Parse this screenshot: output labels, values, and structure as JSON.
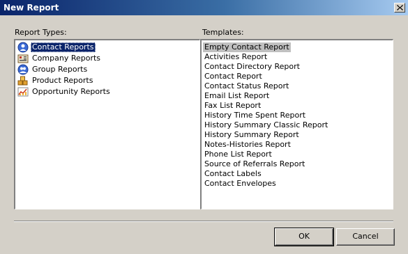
{
  "window": {
    "title": "New Report",
    "close_icon": "close-icon"
  },
  "report_types": {
    "label": "Report Types:",
    "items": [
      {
        "label": "Contact Reports",
        "icon": "contact-icon",
        "selected": true
      },
      {
        "label": "Company Reports",
        "icon": "company-icon",
        "selected": false
      },
      {
        "label": "Group Reports",
        "icon": "group-icon",
        "selected": false
      },
      {
        "label": "Product Reports",
        "icon": "product-icon",
        "selected": false
      },
      {
        "label": "Opportunity Reports",
        "icon": "opportunity-icon",
        "selected": false
      }
    ]
  },
  "templates": {
    "label": "Templates:",
    "items": [
      "Empty Contact Report",
      "Activities Report",
      "Contact Directory Report",
      "Contact Report",
      "Contact Status Report",
      "Email List Report",
      "Fax List Report",
      "History Time Spent Report",
      "History Summary Classic Report",
      "History Summary Report",
      "Notes-Histories Report",
      "Phone List Report",
      "Source of Referrals Report",
      "Contact Labels",
      "Contact Envelopes"
    ],
    "selected_index": 0
  },
  "buttons": {
    "ok": "OK",
    "cancel": "Cancel"
  },
  "colors": {
    "titlebar_start": "#0a246a",
    "titlebar_end": "#a6caf0",
    "dialog_bg": "#d4d0c8",
    "selection": "#0a246a",
    "template_selection": "#c0c0c0"
  }
}
